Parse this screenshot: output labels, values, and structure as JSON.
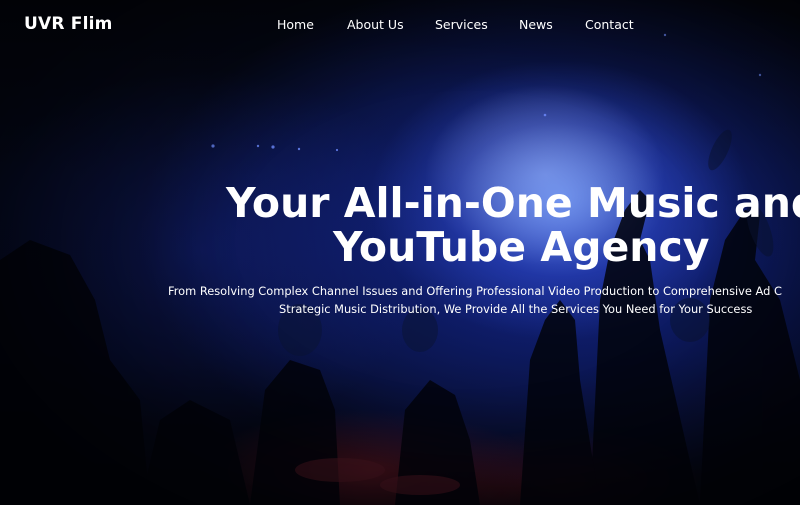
{
  "nav": {
    "logo": "UVR Flim",
    "items": [
      {
        "label": "Home"
      },
      {
        "label": "About Us"
      },
      {
        "label": "Services"
      },
      {
        "label": "News"
      },
      {
        "label": "Contact"
      }
    ]
  },
  "hero": {
    "headline_line1": "Your All-in-One Music and",
    "headline_line2": "YouTube Agency",
    "subtitle_line1": "From Resolving Complex Channel Issues and Offering Professional Video Production to Comprehensive Ad C",
    "subtitle_line2": "Strategic Music Distribution, We Provide All the Services You Need for Your Success"
  },
  "colors": {
    "background": "#03050f",
    "light_blue": "#3c5ae6",
    "text": "#ffffff"
  }
}
